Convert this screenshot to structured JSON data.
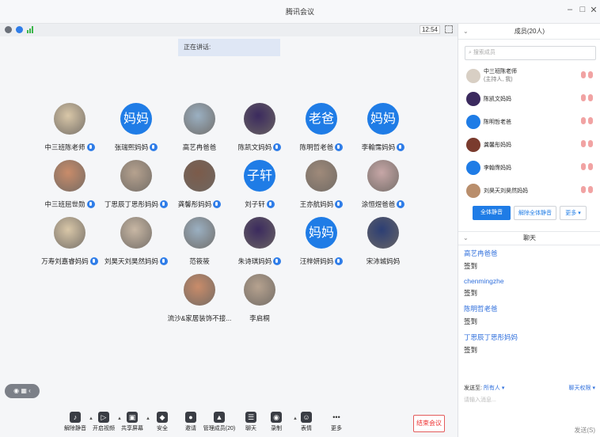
{
  "window": {
    "title": "腾讯会议",
    "minimize": "–",
    "maximize": "□",
    "close": "✕"
  },
  "status": {
    "time": "12:54"
  },
  "speaking": {
    "label": "正在讲话:"
  },
  "participants": [
    {
      "name": "中三班陈老师",
      "avatar": "photo",
      "mic": true
    },
    {
      "name": "张瑞熙妈妈",
      "avatar": "text",
      "avatar_text": "妈妈",
      "mic": true
    },
    {
      "name": "高艺冉爸爸",
      "avatar": "photo",
      "mic": false
    },
    {
      "name": "陈凯文妈妈",
      "avatar": "photo",
      "mic": true
    },
    {
      "name": "陈明哲老爸",
      "avatar": "text",
      "avatar_text": "老爸",
      "mic": true
    },
    {
      "name": "李翰霈妈妈",
      "avatar": "text",
      "avatar_text": "妈妈",
      "mic": true
    },
    {
      "name": "中三班屈世勋",
      "avatar": "photo",
      "mic": true
    },
    {
      "name": "丁思辰丁思彤妈妈",
      "avatar": "photo",
      "mic": true
    },
    {
      "name": "龚馨彤妈妈",
      "avatar": "photo",
      "mic": true
    },
    {
      "name": "刘子轩",
      "avatar": "text",
      "avatar_text": "子轩",
      "mic": true
    },
    {
      "name": "王亦航妈妈",
      "avatar": "photo",
      "mic": true
    },
    {
      "name": "涂恒煜爸爸",
      "avatar": "photo",
      "mic": true
    },
    {
      "name": "万寿刘嘉睿妈妈",
      "avatar": "photo",
      "mic": true
    },
    {
      "name": "刘昊天刘昊然妈妈",
      "avatar": "photo",
      "mic": true
    },
    {
      "name": "范筱筱",
      "avatar": "photo",
      "mic": false
    },
    {
      "name": "朱诗琪妈妈",
      "avatar": "photo",
      "mic": true
    },
    {
      "name": "汪梓妍妈妈",
      "avatar": "text",
      "avatar_text": "妈妈",
      "mic": true
    },
    {
      "name": "宋沛城妈妈",
      "avatar": "photo",
      "mic": false
    },
    {
      "name": "流沙&家居装饰不接...",
      "avatar": "photo",
      "mic": false
    },
    {
      "name": "李启桐",
      "avatar": "photo",
      "mic": false
    }
  ],
  "toolbar": {
    "items": [
      {
        "label": "解除静音",
        "icon": "mic-muted-icon"
      },
      {
        "label": "开启视频",
        "icon": "video-off-icon"
      },
      {
        "label": "共享屏幕",
        "icon": "share-screen-icon"
      },
      {
        "label": "安全",
        "icon": "shield-icon"
      },
      {
        "label": "邀请",
        "icon": "invite-icon"
      },
      {
        "label": "管理成员(20)",
        "icon": "members-icon"
      },
      {
        "label": "聊天",
        "icon": "chat-icon"
      },
      {
        "label": "录制",
        "icon": "record-icon"
      },
      {
        "label": "表情",
        "icon": "emoji-icon"
      },
      {
        "label": "更多",
        "icon": "more-icon"
      }
    ],
    "end_label": "结束会议"
  },
  "members_panel": {
    "title": "成员(20人)",
    "search_placeholder": "搜索成员",
    "members": [
      {
        "name": "中三班陈老师",
        "sub": "(主持人, 我)"
      },
      {
        "name": "陈凯文妈妈"
      },
      {
        "name": "陈明哲老爸"
      },
      {
        "name": "龚馨彤妈妈"
      },
      {
        "name": "李翰霈妈妈"
      },
      {
        "name": "刘昊天刘昊然妈妈"
      }
    ],
    "mute_all": "全体静音",
    "unmute_all": "解除全体静音",
    "more": "更多 ▾"
  },
  "chat_panel": {
    "title": "聊天",
    "messages": [
      {
        "sender": "高艺冉爸爸",
        "text": "签到"
      },
      {
        "sender": "chenmingzhe",
        "text": "签到"
      },
      {
        "sender": "陈明哲老爸",
        "text": "签到"
      },
      {
        "sender": "丁思辰丁思彤妈妈",
        "text": "签到"
      }
    ],
    "send_to_label": "发送至:",
    "send_to_value": "所有人 ▾",
    "permission": "聊天权限 ▾",
    "input_placeholder": "请输入消息...",
    "send_button": "发送(S)"
  },
  "colors": {
    "accent": "#1f7ce6",
    "end_button": "#e33333"
  }
}
